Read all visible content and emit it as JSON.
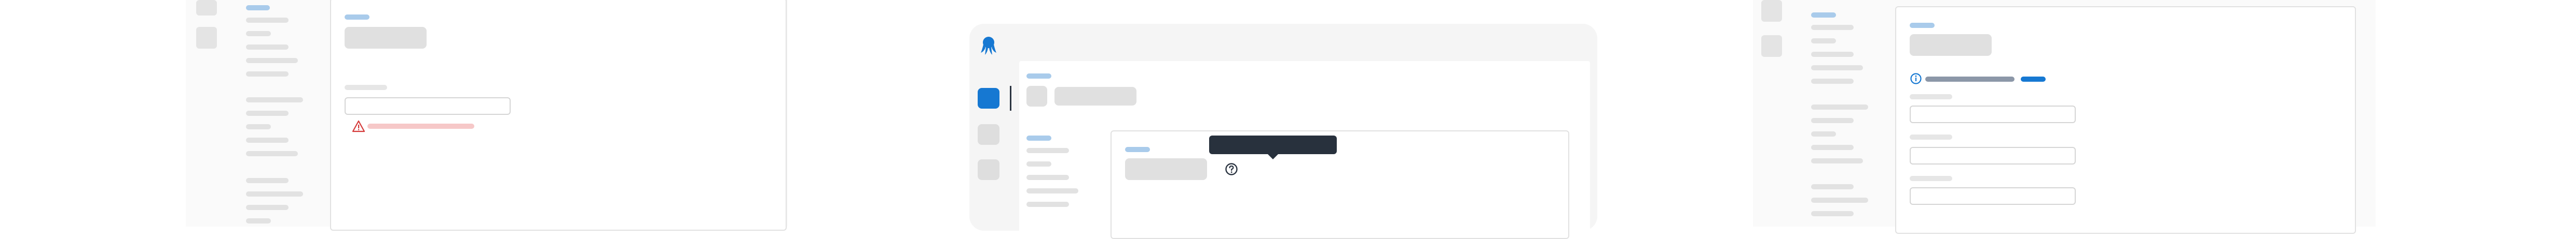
{
  "colors": {
    "skeleton": "#e0e0e0",
    "skeleton_light": "#eaeaea",
    "accent_light": "#a9cbeb",
    "accent": "#1678d2",
    "error_line": "#f6c8c8",
    "error": "#d53a3a",
    "tooltip_bg": "#28313d",
    "info_bar": "#8c97a8"
  },
  "icons": {
    "warning": "warning-triangle-icon",
    "help": "question-circle-icon",
    "info": "info-circle-icon",
    "logo": "octopus-logo-icon"
  }
}
